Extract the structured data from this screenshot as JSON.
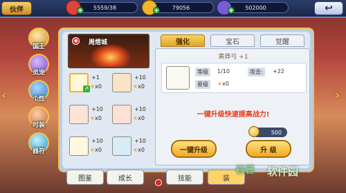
{
  "header": {
    "title": "伙伴",
    "resources": [
      {
        "value": "5559/38",
        "icon": "health-icon",
        "color": "#e0443a"
      },
      {
        "value": "79056",
        "icon": "gold-coin-icon",
        "color": "#f3b52a"
      },
      {
        "value": "502000",
        "icon": "gem-icon",
        "color": "#7a5cd6"
      }
    ],
    "back_icon": "back-arrow-icon"
  },
  "left_rail": [
    {
      "label": "国王",
      "icon": "king-icon"
    },
    {
      "label": "灵宠",
      "icon": "pet-icon"
    },
    {
      "label": "个性",
      "icon": "personality-icon"
    },
    {
      "label": "时装",
      "icon": "costume-icon"
    },
    {
      "label": "器符",
      "icon": "rune-icon"
    }
  ],
  "hero": {
    "name": "周煜城",
    "badge": "◉"
  },
  "equipment": [
    {
      "plus": "+1",
      "stars": "x0",
      "icon": "bow-icon",
      "selected": true
    },
    {
      "plus": "+10",
      "stars": "x0",
      "icon": "armor-icon"
    },
    {
      "plus": "+10",
      "stars": "x0",
      "icon": "bracelet-icon"
    },
    {
      "plus": "+10",
      "stars": "x0",
      "icon": "ring-icon"
    },
    {
      "plus": "+10",
      "stars": "x0",
      "icon": "necklace-icon"
    },
    {
      "plus": "+10",
      "stars": "x0",
      "icon": "book-icon"
    }
  ],
  "tabs": [
    {
      "label": "强化",
      "active": true
    },
    {
      "label": "宝石",
      "active": false
    },
    {
      "label": "觉醒",
      "active": false
    }
  ],
  "detail": {
    "item_title": "黄莽弓 +1",
    "level_key": "等级",
    "level_value": "1/10",
    "attack_key": "攻击:",
    "attack_value": "+22",
    "star_key": "星级",
    "star_value": "x0",
    "promo": "一键升级快速提高战力!",
    "gold_cost": "500",
    "one_click_label": "一键升级",
    "upgrade_label": "升 级"
  },
  "bottom_tabs": [
    {
      "label": "图鉴",
      "active": false
    },
    {
      "label": "成长",
      "active": false
    },
    {
      "label": "技能",
      "active": false
    },
    {
      "label": "装",
      "active": true
    }
  ],
  "watermark": {
    "logo": "谷普",
    "text": "软件园"
  }
}
